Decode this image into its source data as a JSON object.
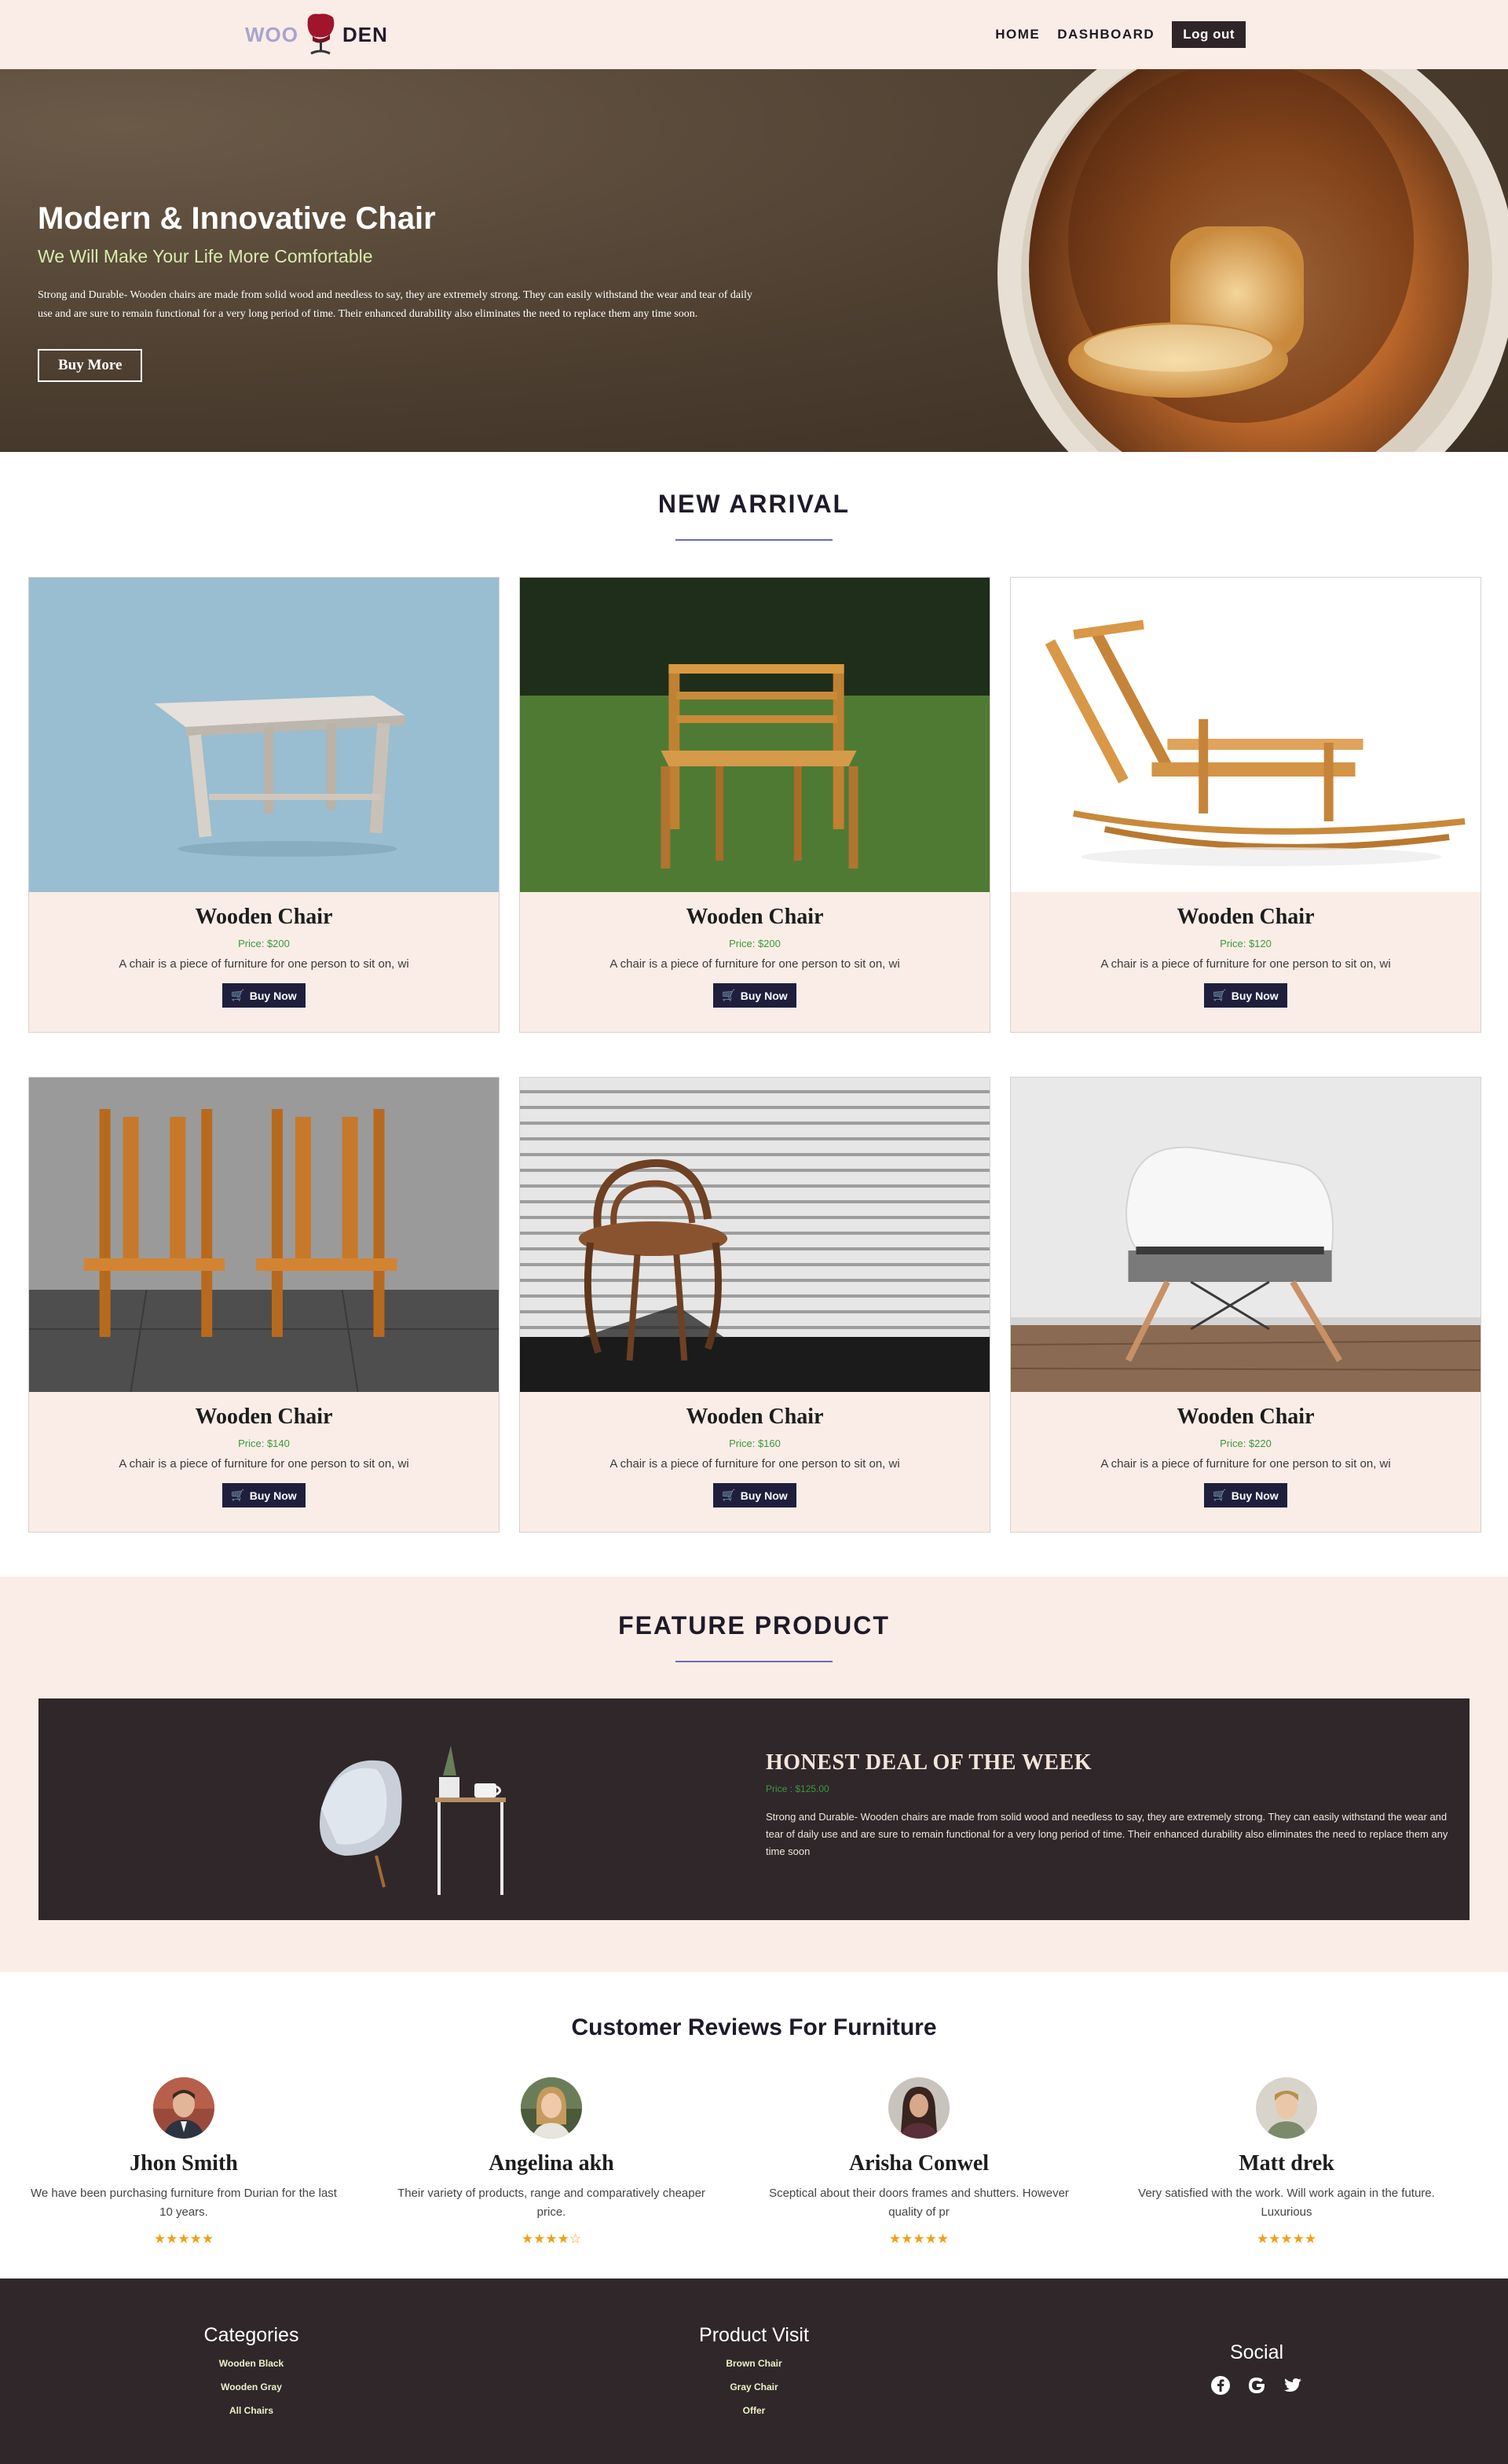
{
  "navbar": {
    "logo_left": "WOO",
    "logo_right": "DEN",
    "links": [
      "HOME",
      "DASHBOARD"
    ],
    "logout": "Log out"
  },
  "hero": {
    "title": "Modern & Innovative Chair",
    "subtitle": "We Will Make Your Life More Comfortable",
    "description": "Strong and Durable- Wooden chairs are made from solid wood and needless to say, they are extremely strong. They can easily withstand the wear and tear of daily use and are sure to remain functional for a very long period of time. Their enhanced durability also eliminates the need to replace them any time soon.",
    "button": "Buy More"
  },
  "new_arrival": {
    "title": "NEW ARRIVAL",
    "products": [
      {
        "name": "Wooden Chair",
        "price": "Price: $200",
        "desc": "A chair is a piece of furniture for one person to sit on, wi",
        "button": "Buy Now"
      },
      {
        "name": "Wooden Chair",
        "price": "Price: $200",
        "desc": "A chair is a piece of furniture for one person to sit on, wi",
        "button": "Buy Now"
      },
      {
        "name": "Wooden Chair",
        "price": "Price: $120",
        "desc": "A chair is a piece of furniture for one person to sit on, wi",
        "button": "Buy Now"
      },
      {
        "name": "Wooden Chair",
        "price": "Price: $140",
        "desc": "A chair is a piece of furniture for one person to sit on, wi",
        "button": "Buy Now"
      },
      {
        "name": "Wooden Chair",
        "price": "Price: $160",
        "desc": "A chair is a piece of furniture for one person to sit on, wi",
        "button": "Buy Now"
      },
      {
        "name": "Wooden Chair",
        "price": "Price: $220",
        "desc": "A chair is a piece of furniture for one person to sit on, wi",
        "button": "Buy Now"
      }
    ]
  },
  "feature": {
    "title": "FEATURE PRODUCT",
    "deal_title": "HONEST DEAL OF THE WEEK",
    "price": "Price : $125.00",
    "description": "Strong and Durable- Wooden chairs are made from solid wood and needless to say, they are extremely strong. They can easily withstand the wear and tear of daily use and are sure to remain functional for a very long period of time. Their enhanced durability also eliminates the need to replace them any time soon"
  },
  "reviews": {
    "title": "Customer Reviews For Furniture",
    "items": [
      {
        "name": "Jhon Smith",
        "text": "We have been purchasing furniture from Durian for the last 10 years.",
        "stars": "★★★★★"
      },
      {
        "name": "Angelina akh",
        "text": "Their variety of products, range and comparatively cheaper price.",
        "stars": "★★★★☆"
      },
      {
        "name": "Arisha Conwel",
        "text": "Sceptical about their doors frames and shutters. However quality of pr",
        "stars": "★★★★★"
      },
      {
        "name": "Matt drek",
        "text": "Very satisfied with the work. Will work again in the future. Luxurious",
        "stars": "★★★★★"
      }
    ]
  },
  "footer": {
    "categories": {
      "title": "Categories",
      "items": [
        "Wooden Black",
        "Wooden Gray",
        "All Chairs"
      ]
    },
    "product_visit": {
      "title": "Product Visit",
      "items": [
        "Brown Chair",
        "Gray Chair",
        "Offer"
      ]
    },
    "social": {
      "title": "Social",
      "icons": [
        "facebook-icon",
        "google-icon",
        "twitter-icon"
      ]
    }
  },
  "colors": {
    "accent": "#1f1f3d",
    "cream": "#faede7",
    "dark": "#30272a",
    "price_green": "#3a9a3a",
    "star": "#f0a01a"
  }
}
